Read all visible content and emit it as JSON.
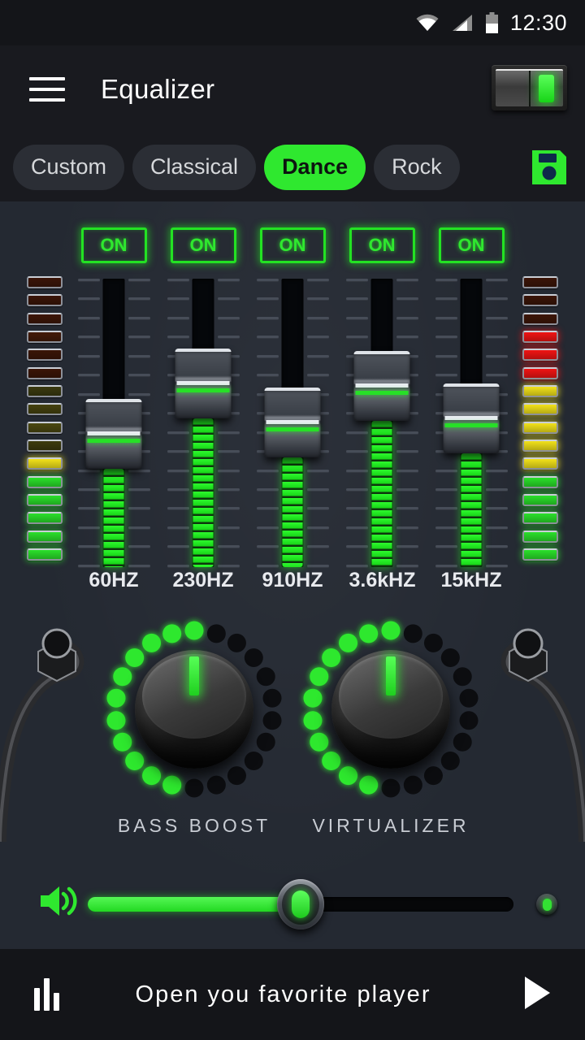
{
  "statusbar": {
    "time": "12:30",
    "icons": [
      "wifi-icon",
      "signal-icon",
      "battery-icon"
    ],
    "battery_level_pct": 50
  },
  "header": {
    "title": "Equalizer",
    "menu_icon": "hamburger-menu-icon",
    "power_toggle": {
      "state": "on",
      "led_color": "#2fe82f"
    }
  },
  "presets": {
    "items": [
      {
        "label": "Custom",
        "active": false
      },
      {
        "label": "Classical",
        "active": false
      },
      {
        "label": "Dance",
        "active": true
      },
      {
        "label": "Rock",
        "active": false
      }
    ],
    "save_icon": "floppy-disk-save-icon",
    "accent_color": "#2fe82f"
  },
  "equalizer": {
    "bands": [
      {
        "freq_label": "60HZ",
        "on_label": "ON",
        "enabled": true,
        "value_pct": 45
      },
      {
        "freq_label": "230HZ",
        "on_label": "ON",
        "enabled": true,
        "value_pct": 68
      },
      {
        "freq_label": "910HZ",
        "on_label": "ON",
        "enabled": true,
        "value_pct": 50
      },
      {
        "freq_label": "3.6kHZ",
        "on_label": "ON",
        "enabled": true,
        "value_pct": 67
      },
      {
        "freq_label": "15kHZ",
        "on_label": "ON",
        "enabled": true,
        "value_pct": 52
      }
    ],
    "tick_count": 16
  },
  "vu_meters": {
    "segment_count": 16,
    "left": {
      "name": "left-channel-vu-meter",
      "level": 6,
      "segments_top_to_bottom": [
        "#3b1508",
        "#3b1508",
        "#3d1608",
        "#431a09",
        "#3a1507",
        "#3a1507",
        "#3b3a10",
        "#45420f",
        "#4b4810",
        "#3e3c0e",
        "#f2e21b",
        "#2be02b",
        "#2be02b",
        "#2be02b",
        "#2be02b",
        "#2be02b"
      ]
    },
    "right": {
      "name": "right-channel-vu-meter",
      "level": 13,
      "segments_top_to_bottom": [
        "#3b1508",
        "#3b1508",
        "#3d1608",
        "#f01414",
        "#f01414",
        "#f01414",
        "#f2e21b",
        "#f2e21b",
        "#f2e21b",
        "#f2e21b",
        "#f2e21b",
        "#2be02b",
        "#2be02b",
        "#2be02b",
        "#2be02b",
        "#2be02b"
      ]
    }
  },
  "knobs": [
    {
      "label": "BASS BOOST",
      "lit_dots": 11,
      "total_dots": 22,
      "pointer_deg": 0
    },
    {
      "label": "VIRTUALIZER",
      "lit_dots": 11,
      "total_dots": 22,
      "pointer_deg": 0
    }
  ],
  "volume": {
    "speaker_icon": "speaker-volume-icon",
    "value_pct": 50,
    "right_dot_icon": "volume-max-dot-icon"
  },
  "bottombar": {
    "eq_icon": "equalizer-bars-icon",
    "text": "Open you favorite player",
    "play_icon": "play-triangle-icon"
  },
  "colors": {
    "accent_green": "#2fe82f",
    "panel_bg": "#242932",
    "header_bg": "#191a1f",
    "statusbar_bg": "#141519"
  }
}
